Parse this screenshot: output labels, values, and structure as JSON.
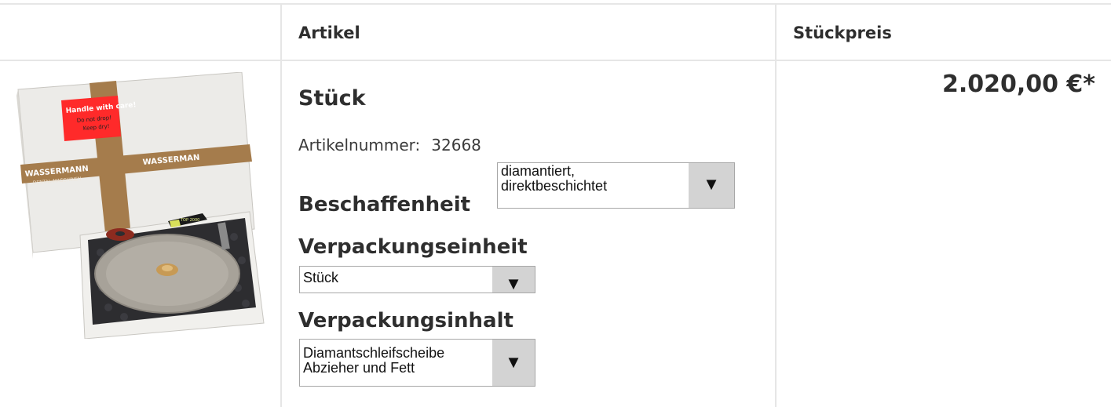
{
  "table": {
    "headers": {
      "article": "Artikel",
      "unit_price": "Stückpreis"
    }
  },
  "product": {
    "title": "Stück",
    "sku_label": "Artikelnummer:",
    "sku_value": "32668",
    "price": "2.020,00 €*",
    "image": {
      "box_text_1": "Handle with care!",
      "box_text_2": "Do not drop!",
      "box_text_3": "Keep dry!",
      "brand": "WASSERMANN",
      "brand_sub": "DENTAL-MASCHINEN",
      "tube_label": "TOP 2000"
    },
    "options": [
      {
        "label": "Beschaffenheit",
        "value": "diamantiert,\ndirektbeschichtet"
      },
      {
        "label": "Verpackungseinheit",
        "value": "Stück"
      },
      {
        "label": "Verpackungsinhalt",
        "value": "Diamantschleifscheibe\nAbzieher und Fett"
      }
    ]
  },
  "icons": {
    "dropdown": "caret-down-icon"
  },
  "colors": {
    "border": "#e6e6e6",
    "select_button": "#d3d3d3",
    "label_red": "#ff2a2a",
    "tape": "#a57c4c"
  }
}
